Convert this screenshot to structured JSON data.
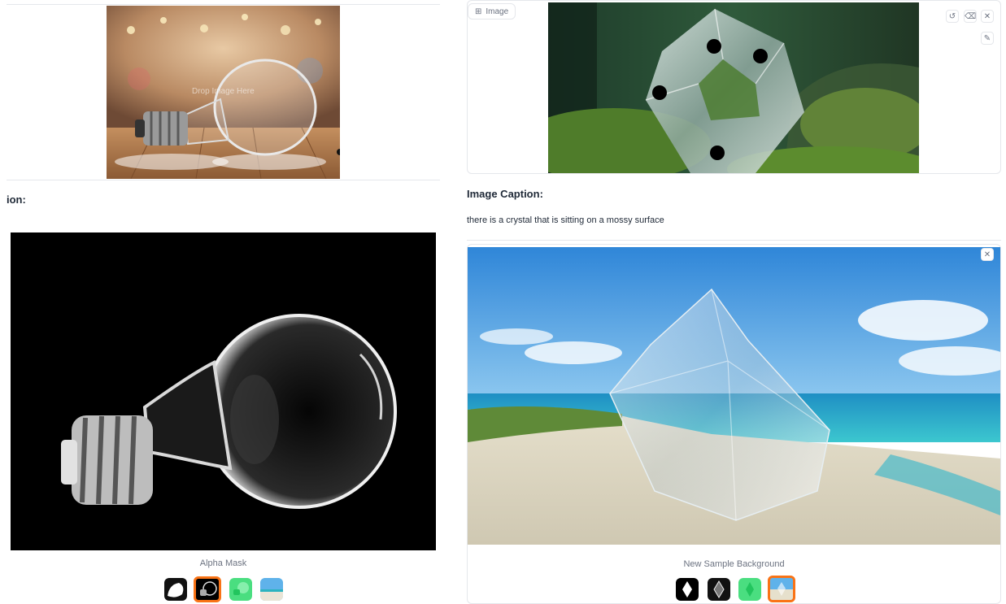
{
  "left": {
    "input_overlay_text": "Drop Image Here",
    "caption_heading_partial": "ion:",
    "alpha_mask_label": "Alpha Mask",
    "thumbnails": [
      {
        "name": "silhouette",
        "selected": false
      },
      {
        "name": "bulb-mask",
        "selected": true
      },
      {
        "name": "green-tint",
        "selected": false
      },
      {
        "name": "beach",
        "selected": false
      }
    ]
  },
  "right": {
    "image_badge_label": "Image",
    "toolbar": {
      "undo_icon": "undo-icon",
      "clear_icon": "eraser-icon",
      "close_icon": "close-icon",
      "brush_icon": "brush-icon"
    },
    "caption_heading": "Image Caption:",
    "caption_text": "there is a crystal that is sitting on a mossy surface",
    "output_close_icon": "close-icon",
    "background_label": "New Sample Background",
    "thumbnails": [
      {
        "name": "silhouette",
        "selected": false
      },
      {
        "name": "crystal-mask",
        "selected": false
      },
      {
        "name": "green-tint",
        "selected": false
      },
      {
        "name": "beach",
        "selected": true
      }
    ]
  },
  "colors": {
    "accent": "#f97316",
    "border": "#e5e7eb",
    "muted_text": "#6b7280"
  }
}
